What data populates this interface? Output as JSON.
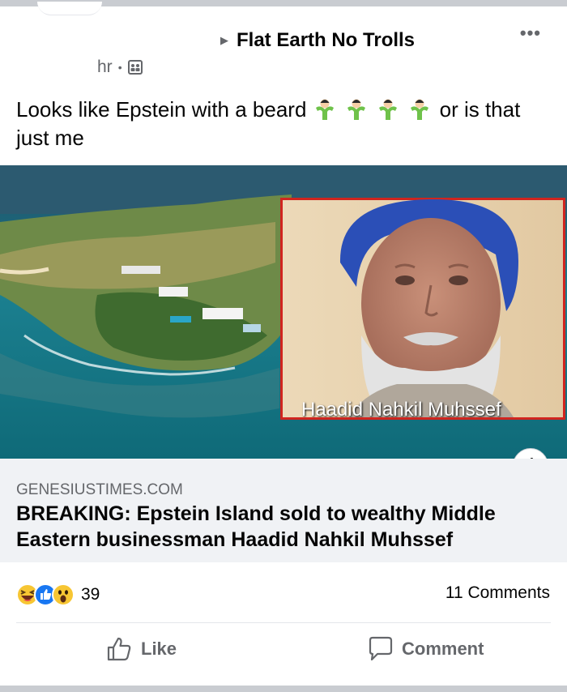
{
  "post": {
    "group_name": "Flat Earth No Trolls",
    "time": "hr",
    "more_icon": "more-horizontal-icon",
    "audience_icon": "group-audience-icon",
    "text_before": "Looks like Epstein with a beard",
    "text_after": "or is that just me",
    "emoji": [
      "man-shrugging",
      "man-shrugging",
      "man-shrugging",
      "man-shrugging"
    ]
  },
  "link": {
    "image_caption": "Haadid Nahkil Muhssef",
    "domain": "GENESIUSTIMES.COM",
    "headline": "BREAKING: Epstein Island sold to wealthy Middle Eastern businessman Haadid Nahkil Muhssef",
    "info_label": "i"
  },
  "engagement": {
    "reaction_icons": [
      "haha-icon",
      "like-icon",
      "wow-icon"
    ],
    "reaction_count": "39",
    "comments": "11 Comments"
  },
  "actions": {
    "like": "Like",
    "comment": "Comment"
  },
  "colors": {
    "text_primary": "#050505",
    "text_secondary": "#65676b",
    "link_meta_bg": "#f0f2f5",
    "like_blue": "#1877f2",
    "photo_frame": "#d0251f"
  }
}
